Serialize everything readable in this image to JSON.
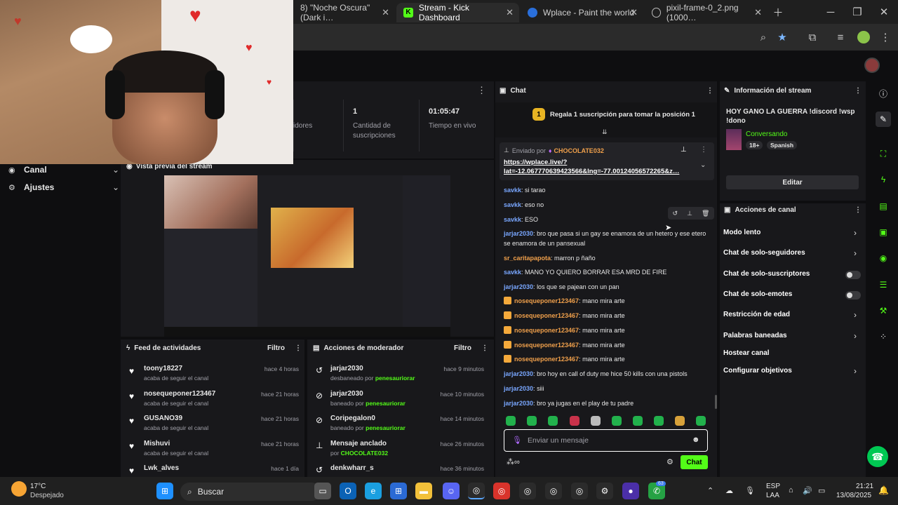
{
  "browser": {
    "tabs": [
      {
        "label": "8) \"Noche Oscura\"(Dark i…"
      },
      {
        "label": "Stream - Kick Dashboard"
      },
      {
        "label": "Wplace - Paint the world"
      },
      {
        "label": "pixil-frame-0_2.png (1000…"
      }
    ]
  },
  "sidebar": {
    "items": [
      {
        "label": "Canal",
        "icon": "broadcast-icon"
      },
      {
        "label": "Ajustes",
        "icon": "gear-icon"
      }
    ]
  },
  "stats": {
    "partial_label": "idores",
    "subs_value": "1",
    "subs_label_1": "Cantidad de",
    "subs_label_2": "suscripciones",
    "live_value": "01:05:47",
    "live_label": "Tiempo en vivo"
  },
  "preview": {
    "title": "Vista previa del stream"
  },
  "activity": {
    "title": "Feed de actividades",
    "filter": "Filtro",
    "rows": [
      {
        "name": "toony18227",
        "sub": "acaba de seguir el canal",
        "time": "hace 4 horas"
      },
      {
        "name": "nosequeponer123467",
        "sub": "acaba de seguir el canal",
        "time": "hace 21 horas"
      },
      {
        "name": "GUSANO39",
        "sub": "acaba de seguir el canal",
        "time": "hace 21 horas"
      },
      {
        "name": "Mishuvi",
        "sub": "acaba de seguir el canal",
        "time": "hace 21 horas"
      },
      {
        "name": "Lwk_alves",
        "sub": "",
        "time": "hace 1 día"
      }
    ]
  },
  "modactions": {
    "title": "Acciones de moderador",
    "filter": "Filtro",
    "rows": [
      {
        "name": "jarjar2030",
        "sub": "desbaneado por",
        "by": "penesauriorar",
        "time": "hace 9 minutos"
      },
      {
        "name": "jarjar2030",
        "sub": "baneado por",
        "by": "penesauriorar",
        "time": "hace 10 minutos"
      },
      {
        "name": "Coripegalon0",
        "sub": "baneado por",
        "by": "penesauriorar",
        "time": "hace 14 minutos"
      },
      {
        "name": "Mensaje anclado",
        "sub": "por",
        "by": "CHOCOLATE032",
        "time": "hace 26 minutos"
      },
      {
        "name": "denkwharr_s",
        "sub": "",
        "by": "",
        "time": "hace 36 minutos"
      }
    ]
  },
  "chat": {
    "title": "Chat",
    "gift_number": "1",
    "gift_text": "Regala 1 suscripción para tomar la posición 1",
    "pinned_by_label": "Enviado por",
    "pinned_by_user": "CHOCOLATE032",
    "pinned_link_1": "https://wplace.live/?",
    "pinned_link_2": "lat=-12.067770639423566&lng=-77.00124056572265&z…",
    "messages": [
      {
        "user": "savkk",
        "text": "si tarao",
        "color": "#79a7ff",
        "badge": false
      },
      {
        "user": "savkk",
        "text": "eso no",
        "color": "#79a7ff",
        "badge": false
      },
      {
        "user": "savkk",
        "text": "ESO",
        "color": "#79a7ff",
        "badge": false
      },
      {
        "user": "jarjar2030",
        "text": "bro que pasa si un gay se enamora de un hetero y ese etero se enamora de un pansexual",
        "color": "#79a7ff",
        "badge": false
      },
      {
        "user": "sr_caritapapota",
        "text": "marron p ñaño",
        "color": "#f0a04b",
        "badge": false
      },
      {
        "user": "savkk",
        "text": "MANO YO QUIERO BORRAR ESA MRD DE FIRE",
        "color": "#79a7ff",
        "badge": false
      },
      {
        "user": "jarjar2030",
        "text": "los que se pajean con un pan",
        "color": "#79a7ff",
        "badge": false
      },
      {
        "user": "nosequeponer123467",
        "text": "mano mira arte",
        "color": "#f0a04b",
        "badge": true
      },
      {
        "user": "nosequeponer123467",
        "text": "mano mira arte",
        "color": "#f0a04b",
        "badge": true
      },
      {
        "user": "nosequeponer123467",
        "text": "mano mira arte",
        "color": "#f0a04b",
        "badge": true
      },
      {
        "user": "nosequeponer123467",
        "text": "mano mira arte",
        "color": "#f0a04b",
        "badge": true
      },
      {
        "user": "nosequeponer123467",
        "text": "mano mira arte",
        "color": "#f0a04b",
        "badge": true
      },
      {
        "user": "jarjar2030",
        "text": "bro hoy en call of duty me hice 50 kills con una pistols",
        "color": "#79a7ff",
        "badge": false
      },
      {
        "user": "jarjar2030",
        "text": "siii",
        "color": "#79a7ff",
        "badge": false
      },
      {
        "user": "jarjar2030",
        "text": "bro ya jugas en el play de tu padre",
        "color": "#79a7ff",
        "badge": false
      }
    ],
    "input_placeholder": "Enviar un mensaje",
    "send_label": "Chat"
  },
  "streaminfo": {
    "title": "Información del stream",
    "stream_title": "HOY GANO LA GUERRA !discord !wsp !dono",
    "category": "Conversando",
    "tag_age": "18+",
    "tag_lang": "Spanish",
    "edit_label": "Editar"
  },
  "channelactions": {
    "title": "Acciones de canal",
    "items": [
      {
        "label": "Modo lento",
        "control": "chevron"
      },
      {
        "label": "Chat de solo-seguidores",
        "control": "chevron"
      },
      {
        "label": "Chat de solo-suscriptores",
        "control": "toggle"
      },
      {
        "label": "Chat de solo-emotes",
        "control": "toggle"
      },
      {
        "label": "Restricción de edad",
        "control": "chevron"
      },
      {
        "label": "Palabras baneadas",
        "control": "chevron"
      },
      {
        "label": "Hostear canal",
        "control": "none"
      },
      {
        "label": "Configurar objetivos",
        "control": "chevron"
      }
    ]
  },
  "taskbar": {
    "temp": "17°C",
    "weather": "Despejado",
    "search": "Buscar",
    "lang_1": "ESP",
    "lang_2": "LAA",
    "time": "21:21",
    "date": "13/08/2025",
    "discord_badge": "63"
  },
  "colors": {
    "accent": "#53fc18",
    "panel": "#18181b",
    "background": "#0e0e10"
  }
}
